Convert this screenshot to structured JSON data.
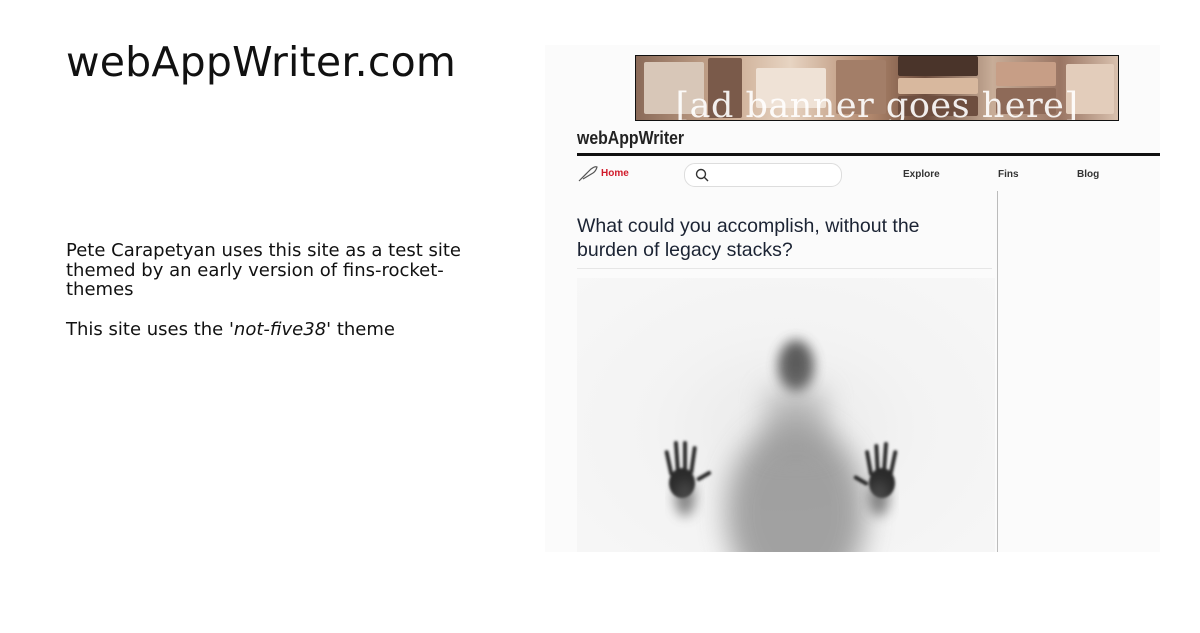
{
  "site_title": "webAppWriter.com",
  "description": {
    "line1": "Pete Carapetyan uses this site as a test site themed by an early version of fins-rocket-themes",
    "theme_prefix": "This site uses the ",
    "theme_name": "'not-five38'",
    "theme_suffix": " theme"
  },
  "preview": {
    "ad_banner_text": "[ad banner goes here]",
    "logo": "webAppWriter",
    "nav": {
      "home": "Home",
      "search_icon": "search-icon",
      "links": [
        "Explore",
        "Fins",
        "Blog"
      ]
    },
    "heading": "What could you accomplish, without the burden of legacy stacks?",
    "accent_color": "#d11a2a"
  }
}
